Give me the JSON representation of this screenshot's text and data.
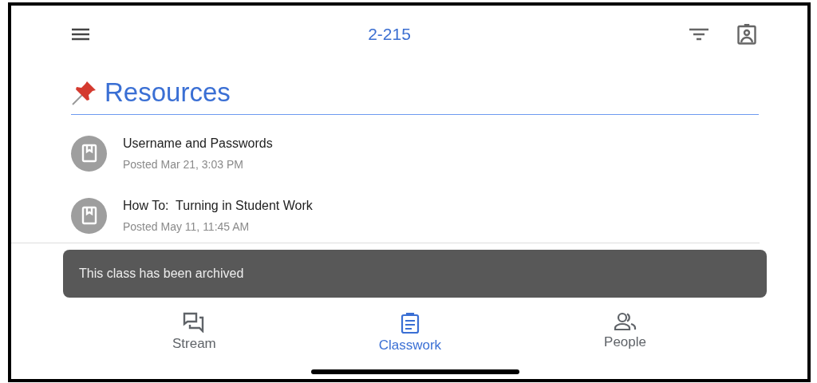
{
  "top_bar": {
    "title": "2-215"
  },
  "section": {
    "title": "Resources"
  },
  "items": [
    {
      "title": "Username and Passwords",
      "subtitle": "Posted Mar 21, 3:03 PM"
    },
    {
      "title": "How To:  Turning in Student Work",
      "subtitle": "Posted May 11, 11:45 AM"
    }
  ],
  "snackbar": {
    "message": "This class has been archived"
  },
  "tabs": [
    {
      "kind": "stream",
      "label": "Stream",
      "selected": false
    },
    {
      "kind": "classwork",
      "label": "Classwork",
      "selected": true
    },
    {
      "kind": "people",
      "label": "People",
      "selected": false
    }
  ]
}
